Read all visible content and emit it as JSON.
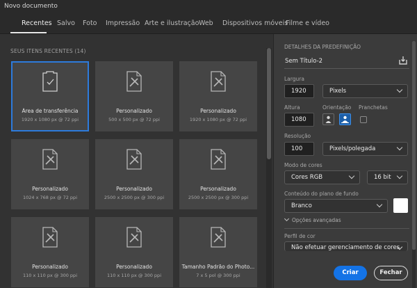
{
  "window": {
    "title": "Novo documento"
  },
  "tabs": [
    {
      "label": "Recentes",
      "active": true
    },
    {
      "label": "Salvo"
    },
    {
      "label": "Foto"
    },
    {
      "label": "Impressão"
    },
    {
      "label": "Arte e ilustração"
    },
    {
      "label": "Web"
    },
    {
      "label": "Dispositivos móveis"
    },
    {
      "label": "Filme e vídeo"
    }
  ],
  "recent": {
    "heading": "SEUS ITENS RECENTES  (14)",
    "items": [
      {
        "name": "Área de transferência",
        "dims": "1920 x 1080 px @ 72 ppi",
        "icon": "clipboard-check-icon",
        "selected": true
      },
      {
        "name": "Personalizado",
        "dims": "500 x 500 px @ 72 ppi",
        "icon": "document-brush-icon"
      },
      {
        "name": "Personalizado",
        "dims": "1920 x 1080 px @ 72 ppi",
        "icon": "document-brush-icon"
      },
      {
        "name": "Personalizado",
        "dims": "1024 x 768 px @ 72 ppi",
        "icon": "document-brush-icon"
      },
      {
        "name": "Personalizado",
        "dims": "2500 x 2500 px @ 300 ppi",
        "icon": "document-brush-icon"
      },
      {
        "name": "Personalizado",
        "dims": "2500 x 2500 px @ 300 ppi",
        "icon": "document-brush-icon"
      },
      {
        "name": "Personalizado",
        "dims": "110 x 110 px @ 300 ppi",
        "icon": "document-brush-icon"
      },
      {
        "name": "Personalizado",
        "dims": "110 x 110 px @ 300 ppi",
        "icon": "document-brush-icon"
      },
      {
        "name": "Tamanho Padrão do Photo...",
        "dims": "7 x 5 pol @ 300 ppi",
        "icon": "document-brush-icon"
      }
    ]
  },
  "details": {
    "heading": "DETALHES DA PREDEFINIÇÃO",
    "preset_name": "Sem Título-2",
    "width_label": "Largura",
    "width_value": "1920",
    "width_unit": "Pixels",
    "height_label": "Altura",
    "height_value": "1080",
    "orientation_label": "Orientação",
    "artboards_label": "Pranchetas",
    "resolution_label": "Resolução",
    "resolution_value": "100",
    "resolution_unit": "Pixels/polegada",
    "color_mode_label": "Modo de cores",
    "color_mode_value": "Cores RGB",
    "bit_depth_value": "16 bit",
    "background_label": "Conteúdo do plano de fundo",
    "background_value": "Branco",
    "background_color": "#ffffff",
    "advanced_label": "Opções avançadas",
    "color_profile_label": "Perfil de cor",
    "color_profile_value": "Não efetuar gerenciamento de cores"
  },
  "actions": {
    "create_label": "Criar",
    "close_label": "Fechar"
  },
  "colors": {
    "accent": "#1473e6",
    "selected_border": "#2d7bdc"
  }
}
